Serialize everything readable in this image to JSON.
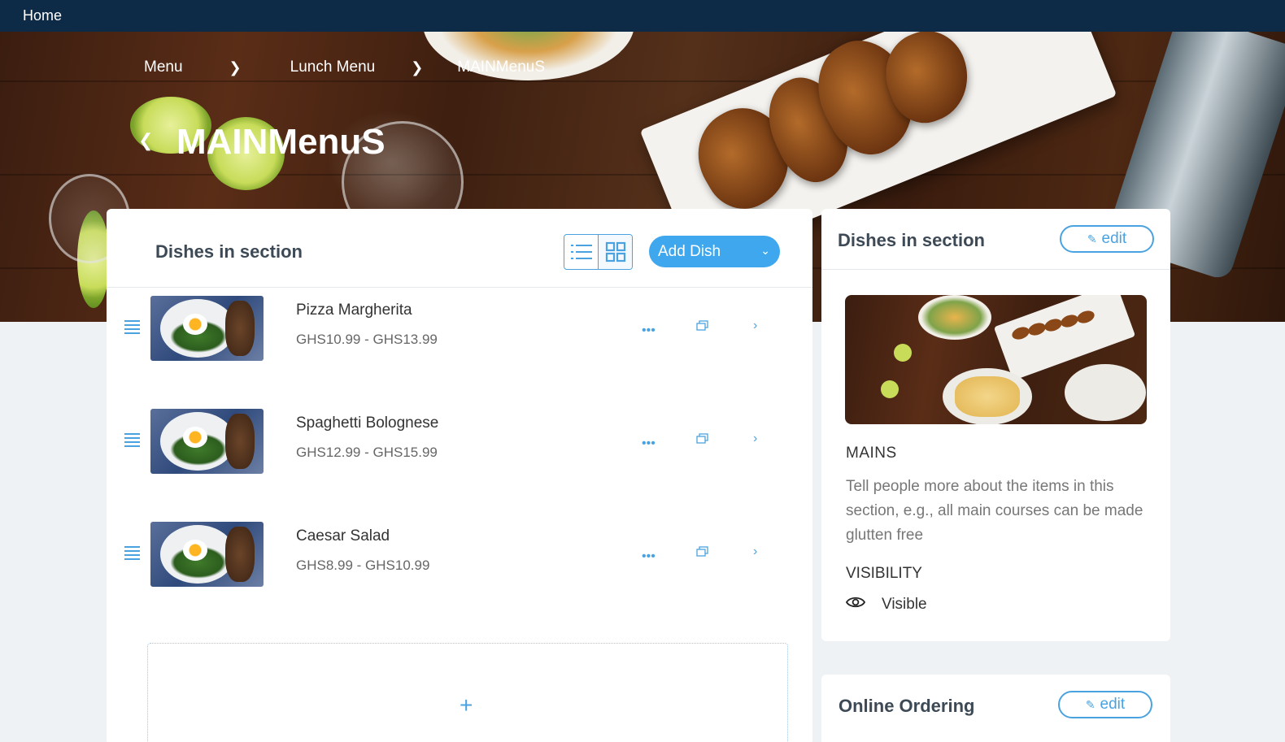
{
  "topbar": {
    "home_label": "Home"
  },
  "breadcrumb": {
    "items": [
      "Menu",
      "Lunch Menu",
      "MAINMenuS"
    ]
  },
  "page": {
    "title": "MAINMenuS"
  },
  "main": {
    "heading": "Dishes in section",
    "add_dish_label": "Add Dish",
    "dishes": [
      {
        "name": "Pizza Margherita",
        "price": "GHS10.99 - GHS13.99"
      },
      {
        "name": "Spaghetti Bolognese",
        "price": "GHS12.99 - GHS15.99"
      },
      {
        "name": "Caesar Salad",
        "price": "GHS8.99 - GHS10.99"
      }
    ]
  },
  "side": {
    "heading": "Dishes in section",
    "edit_label": "edit",
    "section_name": "MAINS",
    "description": "Tell people more about the items in this section, e.g., all main courses can be made glutten free",
    "visibility_label": "VISIBILITY",
    "visibility_value": "Visible"
  },
  "ordering": {
    "heading": "Online Ordering",
    "edit_label": "edit"
  },
  "colors": {
    "accent": "#3ea7ee",
    "topbar": "#0d2a47"
  }
}
